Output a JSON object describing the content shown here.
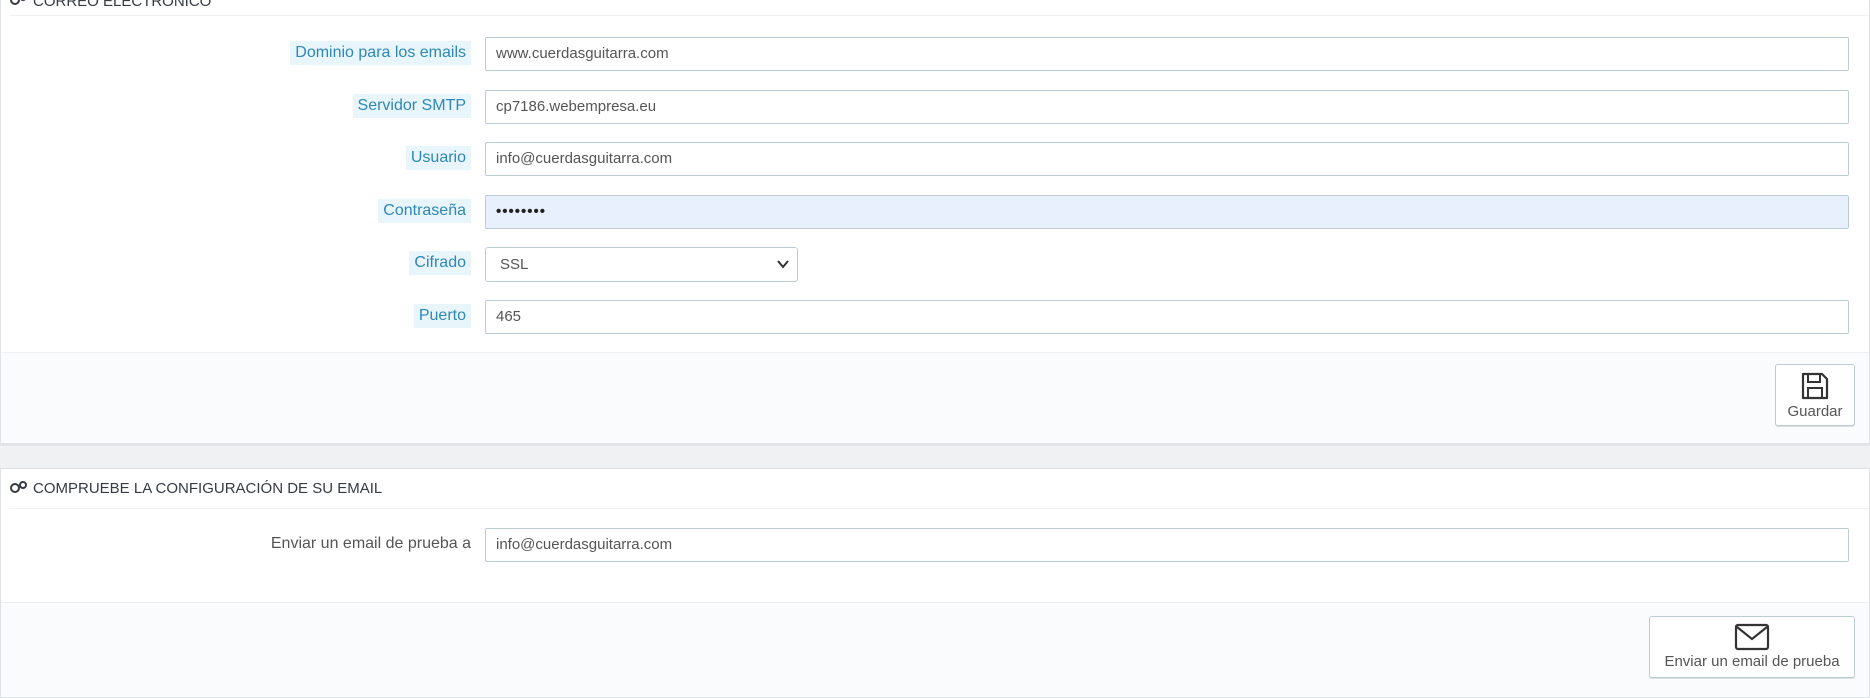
{
  "email_panel": {
    "title": "CORREO ELECTRÓNICO",
    "fields": {
      "domain": {
        "label": "Dominio para los emails",
        "value": "www.cuerdasguitarra.com"
      },
      "smtp_server": {
        "label": "Servidor SMTP",
        "value": "cp7186.webempresa.eu"
      },
      "user": {
        "label": "Usuario",
        "value": "info@cuerdasguitarra.com"
      },
      "password": {
        "label": "Contraseña",
        "value": "••••••••"
      },
      "encryption": {
        "label": "Cifrado",
        "value": "SSL"
      },
      "port": {
        "label": "Puerto",
        "value": "465"
      }
    },
    "save_label": "Guardar"
  },
  "test_panel": {
    "title": "COMPRUEBE LA CONFIGURACIÓN DE SU EMAIL",
    "field": {
      "label": "Enviar un email de prueba a",
      "value": "info@cuerdasguitarra.com"
    },
    "send_label": "Enviar un email de prueba"
  },
  "icons": {
    "panel_heading": "gears-icon",
    "save": "floppy-disk-icon",
    "send": "envelope-icon",
    "select": "chevron-down-icon"
  }
}
